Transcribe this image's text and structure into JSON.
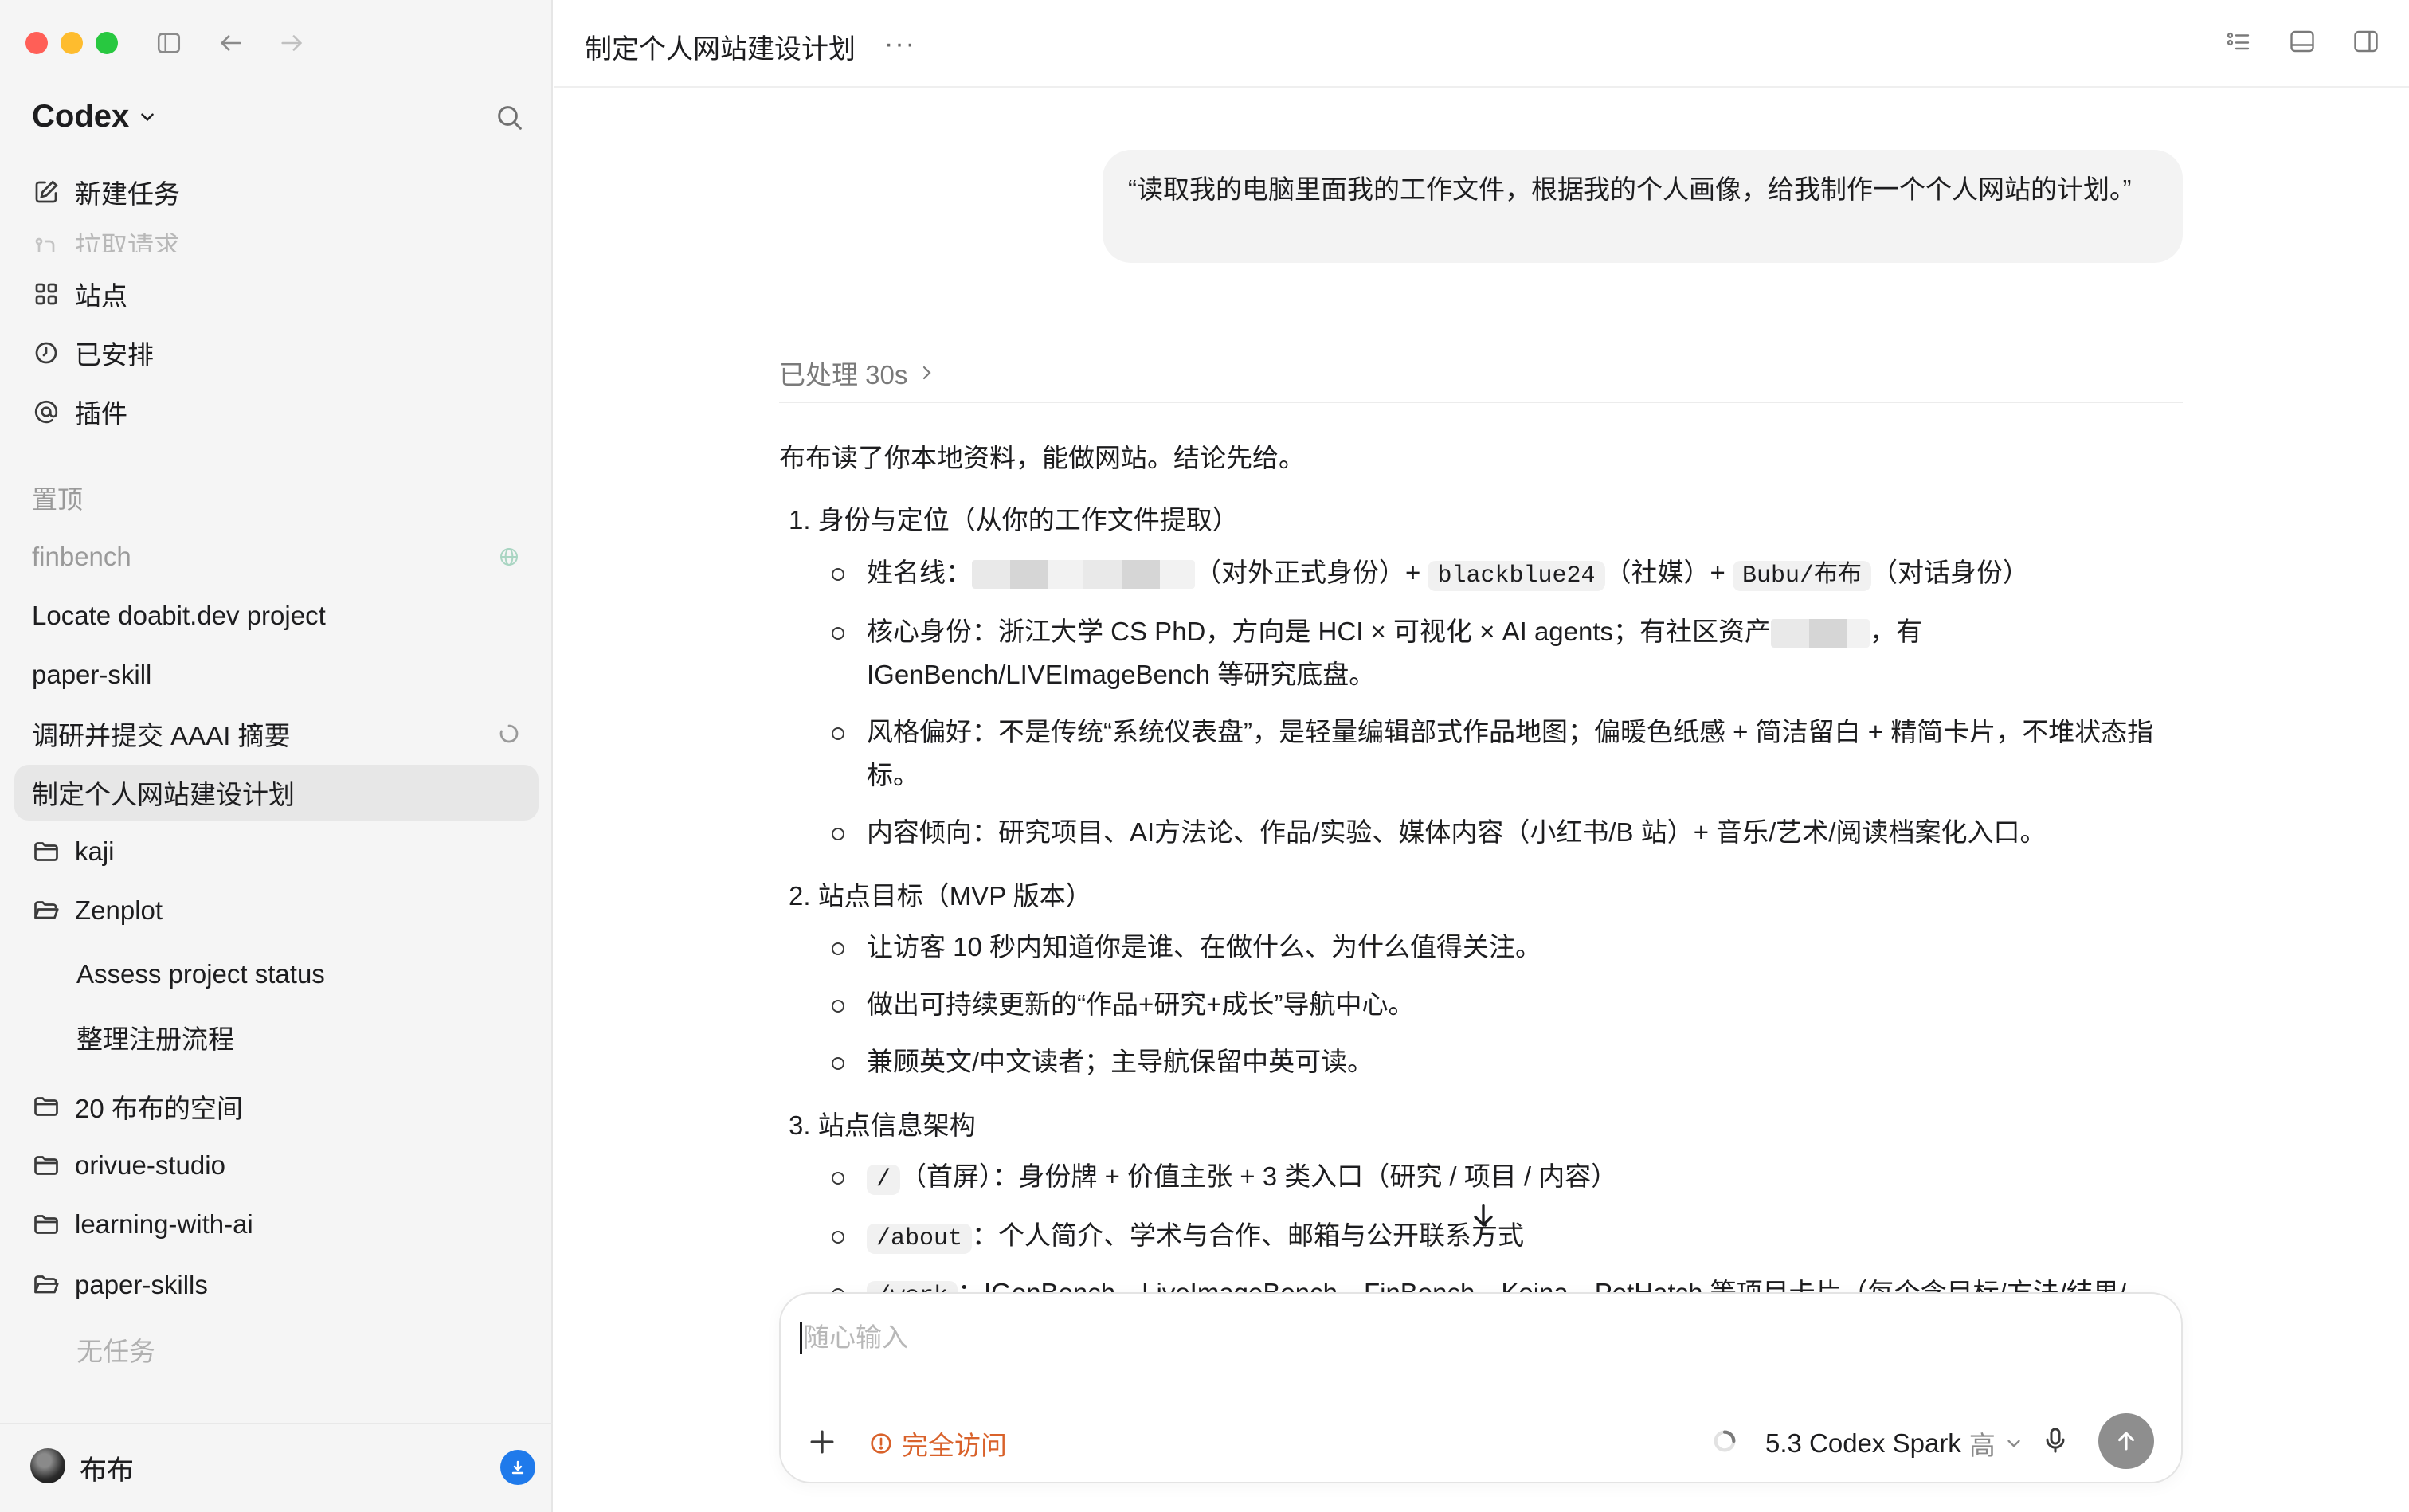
{
  "sidebar": {
    "brand": "Codex",
    "nav": {
      "new_task": "新建任务",
      "pull_requests": "拉取请求",
      "sites": "站点",
      "scheduled": "已安排",
      "plugins": "插件"
    },
    "pinned_title": "置顶",
    "threads": [
      {
        "label": "finbench"
      },
      {
        "label": "Locate doabit.dev project"
      },
      {
        "label": "paper-skill"
      },
      {
        "label": "调研并提交 AAAI 摘要"
      },
      {
        "label": "制定个人网站建设计划"
      }
    ],
    "folders": [
      {
        "label": "kaji"
      },
      {
        "label": "Zenplot",
        "children": [
          "Assess project status",
          "整理注册流程"
        ]
      },
      {
        "label": "20 布布的空间"
      },
      {
        "label": "orivue-studio"
      },
      {
        "label": "learning-with-ai"
      },
      {
        "label": "paper-skills",
        "empty_label": "无任务"
      }
    ],
    "user": {
      "name": "布布"
    }
  },
  "main": {
    "title": "制定个人网站建设计划",
    "more": "···",
    "user_message": "“读取我的电脑里面我的工作文件，根据我的个人画像，给我制作一个个人网站的计划。”",
    "processed": "已处理 30s",
    "response": {
      "intro": "布布读了你本地资料，能做网站。结论先给。",
      "s1": {
        "title": "1.  身份与定位（从你的工作文件提取）",
        "i1": {
          "a": "姓名线：",
          "b": "（对外正式身份）+",
          "c": "blackblue24",
          "d": "（社媒）+",
          "e": "Bubu/布布",
          "f": "（对话身份）"
        },
        "i2": {
          "a": "核心身份：浙江大学 CS PhD，方向是 HCI × 可视化 × AI agents；有社区资产",
          "b": "，有 IGenBench/LIVEImageBench 等研究底盘。"
        },
        "i3": "风格偏好：不是传统“系统仪表盘”，是轻量编辑部式作品地图；偏暖色纸感 + 简洁留白 + 精简卡片，不堆状态指标。",
        "i4": "内容倾向：研究项目、AI方法论、作品/实验、媒体内容（小红书/B 站）+ 音乐/艺术/阅读档案化入口。"
      },
      "s2": {
        "title": "2.  站点目标（MVP 版本）",
        "i1": "让访客 10 秒内知道你是谁、在做什么、为什么值得关注。",
        "i2": "做出可持续更新的“作品+研究+成长”导航中心。",
        "i3": "兼顾英文/中文读者；主导航保留中英可读。"
      },
      "s3": {
        "title": "3.  站点信息架构",
        "i1": {
          "code": "/",
          "text": "（首屏）：身份牌 + 价值主张 + 3 类入口（研究 / 项目 / 内容）"
        },
        "i2": {
          "code": "/about",
          "text": "：个人简介、学术与合作、邮箱与公开联系方式"
        },
        "i3": {
          "code": "/work",
          "text": "：IGenBench、LiveImageBench、FinBench、Koina、PetHatch 等项目卡片（每个含目标/方法/结果/"
        }
      }
    }
  },
  "composer": {
    "placeholder": "随心输入",
    "access": "完全访问",
    "model": "5.3 Codex Spark",
    "effort": "高"
  }
}
